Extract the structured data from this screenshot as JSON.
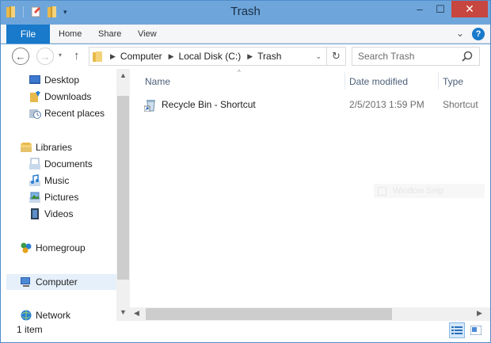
{
  "window": {
    "title": "Trash",
    "minimize_icon": "minimize-icon",
    "maximize_icon": "maximize-icon",
    "close_icon": "close-icon",
    "close_label": "✕",
    "minimize_label": "–",
    "maximize_label": "☐"
  },
  "colors": {
    "titlebar": "#6ea6db",
    "file_tab": "#1979ca",
    "close_button": "#c7463f",
    "selection": "#e5f0fb"
  },
  "ribbon": {
    "file_tab": "File",
    "tabs": [
      "Home",
      "Share",
      "View"
    ],
    "expand_label": "⌄",
    "help_label": "?"
  },
  "navigation": {
    "back_label": "←",
    "forward_label": "→",
    "recent_label": "▾",
    "up_label": "↑",
    "breadcrumb": [
      "Computer",
      "Local Disk (C:)",
      "Trash"
    ],
    "address_dropdown_label": "⌄",
    "refresh_label": "↻",
    "search_placeholder": "Search Trash"
  },
  "nav_pane": {
    "items": [
      {
        "label": "Desktop",
        "icon": "desktop-icon"
      },
      {
        "label": "Downloads",
        "icon": "downloads-icon"
      },
      {
        "label": "Recent places",
        "icon": "recent-places-icon"
      },
      {
        "label": "Libraries",
        "icon": "libraries-icon"
      },
      {
        "label": "Documents",
        "icon": "documents-icon"
      },
      {
        "label": "Music",
        "icon": "music-icon"
      },
      {
        "label": "Pictures",
        "icon": "pictures-icon"
      },
      {
        "label": "Videos",
        "icon": "videos-icon"
      },
      {
        "label": "Homegroup",
        "icon": "homegroup-icon"
      },
      {
        "label": "Computer",
        "icon": "computer-icon",
        "selected": true
      },
      {
        "label": "Network",
        "icon": "network-icon"
      }
    ],
    "scroll_up_label": "▲",
    "scroll_down_label": "▼"
  },
  "file_list": {
    "columns": [
      "Name",
      "Date modified",
      "Type"
    ],
    "sort_indicator": "^",
    "rows": [
      {
        "name": "Recycle Bin - Shortcut",
        "date_modified": "2/5/2013 1:59 PM",
        "type": "Shortcut",
        "icon": "shortcut-icon"
      }
    ],
    "scroll_left_label": "◀",
    "scroll_right_label": "▶"
  },
  "ghost_item": {
    "label": "Window Snip",
    "icon": "snip-icon"
  },
  "status": {
    "item_count": "1 item"
  }
}
